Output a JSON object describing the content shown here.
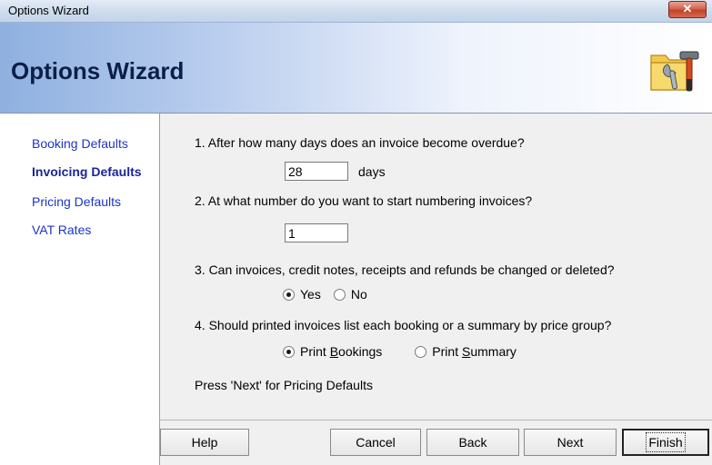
{
  "window": {
    "title": "Options Wizard",
    "close_glyph": "✕"
  },
  "header": {
    "title": "Options Wizard",
    "icon": "tools-wizard-icon"
  },
  "sidebar": {
    "items": [
      {
        "label": "Booking Defaults",
        "active": false
      },
      {
        "label": "Invoicing Defaults",
        "active": true
      },
      {
        "label": "Pricing Defaults",
        "active": false
      },
      {
        "label": "VAT Rates",
        "active": false
      }
    ]
  },
  "content": {
    "q1": {
      "label": "1. After how many days does an invoice become overdue?",
      "value": "28",
      "unit": "days"
    },
    "q2": {
      "label": "2. At what number do you want to start numbering invoices?",
      "value": "1"
    },
    "q3": {
      "label": "3. Can invoices, credit notes, receipts and refunds be changed or deleted?",
      "options": [
        {
          "label": "Yes",
          "checked": true
        },
        {
          "label": "No",
          "checked": false
        }
      ]
    },
    "q4": {
      "label": "4. Should printed invoices list each booking or a summary by price group?",
      "options": [
        {
          "label_pre": "Print ",
          "label_mnemonic": "B",
          "label_post": "ookings",
          "checked": true
        },
        {
          "label_pre": "Print ",
          "label_mnemonic": "S",
          "label_post": "ummary",
          "checked": false
        }
      ]
    },
    "hint": "Press 'Next' for Pricing Defaults"
  },
  "buttons": {
    "help": "Help",
    "cancel": "Cancel",
    "back": "Back",
    "next": "Next",
    "finish": "Finish"
  },
  "colors": {
    "link": "#1c34c8",
    "active_link": "#1a2596",
    "header_title": "#0b1f47",
    "content_bg": "#f0f0f0"
  }
}
